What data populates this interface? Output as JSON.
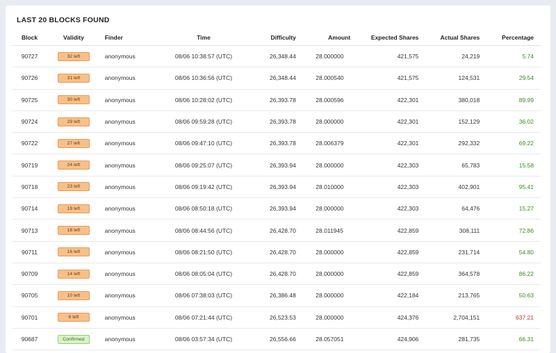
{
  "title": "LAST 20 BLOCKS FOUND",
  "columns": [
    "Block",
    "Validity",
    "Finder",
    "Time",
    "Difficulty",
    "Amount",
    "Expected Shares",
    "Actual Shares",
    "Percentage"
  ],
  "colors": {
    "green": "#3c8a1c",
    "red": "#c0392b",
    "badge_pending": "#f7c08a",
    "badge_confirmed": "#d9f2c9"
  },
  "rows": [
    {
      "block": "90727",
      "validity": "32 left",
      "status": "pending",
      "finder": "anonymous",
      "time": "08/06 10:38:57 (UTC)",
      "difficulty": "26,348.44",
      "amount": "28.000000",
      "expected": "421,575",
      "actual": "24,219",
      "percentage": "5.74",
      "pct_color": "green"
    },
    {
      "block": "90726",
      "validity": "31 left",
      "status": "pending",
      "finder": "anonymous",
      "time": "08/06 10:36:56 (UTC)",
      "difficulty": "26,348.44",
      "amount": "28.000540",
      "expected": "421,575",
      "actual": "124,531",
      "percentage": "29.54",
      "pct_color": "green"
    },
    {
      "block": "90725",
      "validity": "30 left",
      "status": "pending",
      "finder": "anonymous",
      "time": "08/06 10:28:02 (UTC)",
      "difficulty": "26,393.78",
      "amount": "28.000596",
      "expected": "422,301",
      "actual": "380,018",
      "percentage": "89.99",
      "pct_color": "green"
    },
    {
      "block": "90724",
      "validity": "29 left",
      "status": "pending",
      "finder": "anonymous",
      "time": "08/06 09:59:28 (UTC)",
      "difficulty": "26,393.78",
      "amount": "28.000000",
      "expected": "422,301",
      "actual": "152,129",
      "percentage": "36.02",
      "pct_color": "green"
    },
    {
      "block": "90722",
      "validity": "27 left",
      "status": "pending",
      "finder": "anonymous",
      "time": "08/06 09:47:10 (UTC)",
      "difficulty": "26,393.78",
      "amount": "28.006379",
      "expected": "422,301",
      "actual": "292,332",
      "percentage": "69.22",
      "pct_color": "green"
    },
    {
      "block": "90719",
      "validity": "24 left",
      "status": "pending",
      "finder": "anonymous",
      "time": "08/06 09:25:07 (UTC)",
      "difficulty": "26,393.94",
      "amount": "28.000000",
      "expected": "422,303",
      "actual": "65,783",
      "percentage": "15.58",
      "pct_color": "green"
    },
    {
      "block": "90718",
      "validity": "23 left",
      "status": "pending",
      "finder": "anonymous",
      "time": "08/06 09:19:42 (UTC)",
      "difficulty": "26,393.94",
      "amount": "28.010000",
      "expected": "422,303",
      "actual": "402,901",
      "percentage": "95.41",
      "pct_color": "green"
    },
    {
      "block": "90714",
      "validity": "19 left",
      "status": "pending",
      "finder": "anonymous",
      "time": "08/06 08:50:18 (UTC)",
      "difficulty": "26,393.94",
      "amount": "28.000000",
      "expected": "422,303",
      "actual": "64,476",
      "percentage": "15.27",
      "pct_color": "green"
    },
    {
      "block": "90713",
      "validity": "18 left",
      "status": "pending",
      "finder": "anonymous",
      "time": "08/06 08:44:56 (UTC)",
      "difficulty": "26,428.70",
      "amount": "28.011945",
      "expected": "422,859",
      "actual": "308,111",
      "percentage": "72.86",
      "pct_color": "green"
    },
    {
      "block": "90711",
      "validity": "16 left",
      "status": "pending",
      "finder": "anonymous",
      "time": "08/06 08:21:50 (UTC)",
      "difficulty": "26,428.70",
      "amount": "28.000000",
      "expected": "422,859",
      "actual": "231,714",
      "percentage": "54.80",
      "pct_color": "green"
    },
    {
      "block": "90709",
      "validity": "14 left",
      "status": "pending",
      "finder": "anonymous",
      "time": "08/06 08:05:04 (UTC)",
      "difficulty": "26,428.70",
      "amount": "28.000000",
      "expected": "422,859",
      "actual": "364,578",
      "percentage": "86.22",
      "pct_color": "green"
    },
    {
      "block": "90705",
      "validity": "10 left",
      "status": "pending",
      "finder": "anonymous",
      "time": "08/06 07:38:03 (UTC)",
      "difficulty": "26,386.48",
      "amount": "28.000000",
      "expected": "422,184",
      "actual": "213,765",
      "percentage": "50.63",
      "pct_color": "green"
    },
    {
      "block": "90701",
      "validity": "6 left",
      "status": "pending",
      "finder": "anonymous",
      "time": "08/06 07:21:44 (UTC)",
      "difficulty": "26,523.53",
      "amount": "28.000000",
      "expected": "424,376",
      "actual": "2,704,151",
      "percentage": "637.21",
      "pct_color": "red"
    },
    {
      "block": "90687",
      "validity": "Confirmed",
      "status": "confirmed",
      "finder": "anonymous",
      "time": "08/06 03:57:34 (UTC)",
      "difficulty": "26,556.66",
      "amount": "28.057051",
      "expected": "424,906",
      "actual": "281,735",
      "percentage": "66.31",
      "pct_color": "green"
    }
  ]
}
